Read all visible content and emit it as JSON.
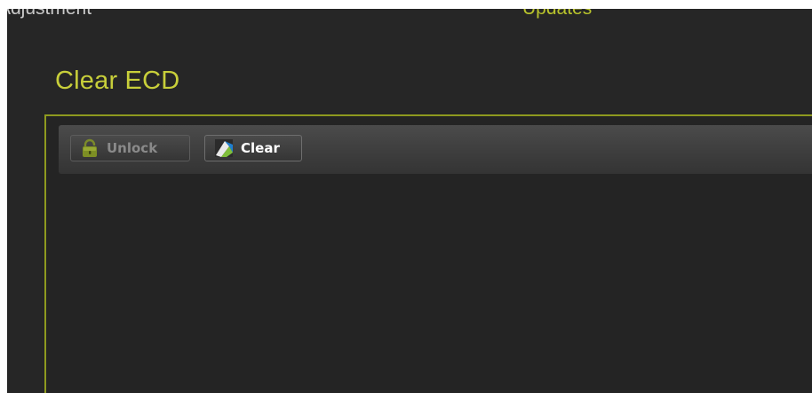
{
  "header": {
    "tabs": [
      {
        "label": "Adjustment"
      },
      {
        "label": "Updates"
      }
    ]
  },
  "page": {
    "title": "Clear ECD"
  },
  "toolbar": {
    "unlock_label": "Unlock",
    "clear_label": "Clear"
  },
  "icons": {
    "unlock": "lock-icon",
    "clear": "eraser-icon"
  },
  "colors": {
    "accent": "#c8cf3a",
    "panel_border": "#8e9a1f",
    "background": "#262626"
  }
}
